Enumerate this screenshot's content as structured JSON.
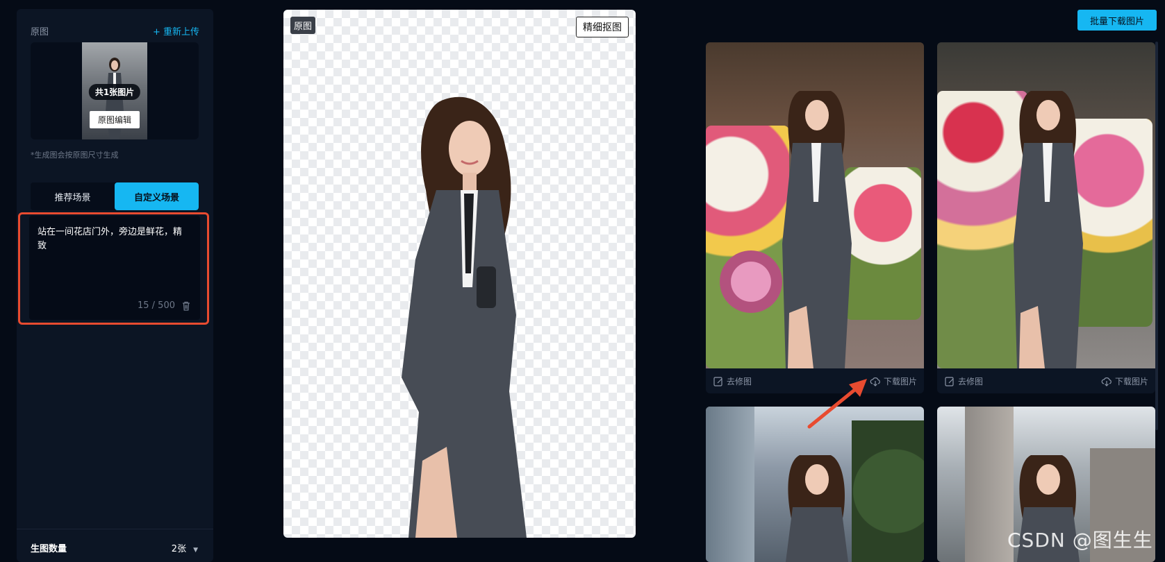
{
  "left_panel": {
    "title": "原图",
    "reupload": "+ 重新上传",
    "thumb_badge": "共1张图片",
    "edit_button": "原图编辑",
    "size_note": "*生成图会按原图尺寸生成",
    "tabs": [
      {
        "label": "推荐场景",
        "active": false
      },
      {
        "label": "自定义场景",
        "active": true
      }
    ],
    "prompt": {
      "text": "站在一间花店门外，旁边是鲜花，精致",
      "counter": "15 / 500"
    },
    "quantity": {
      "label": "生图数量",
      "value": "2张"
    }
  },
  "canvas": {
    "tag": "原图",
    "refine_button": "精细抠图"
  },
  "gallery": {
    "batch_download": "批量下载图片",
    "cards": [
      {
        "scene": "flower-shop",
        "retouch": "去修图",
        "download": "下载图片"
      },
      {
        "scene": "flower-shop",
        "retouch": "去修图",
        "download": "下载图片"
      },
      {
        "scene": "city-street"
      },
      {
        "scene": "city-street"
      }
    ]
  },
  "watermark": "CSDN @图生生",
  "colors": {
    "accent": "#16b7f2",
    "highlight": "#e84b30",
    "background": "#050b16"
  }
}
